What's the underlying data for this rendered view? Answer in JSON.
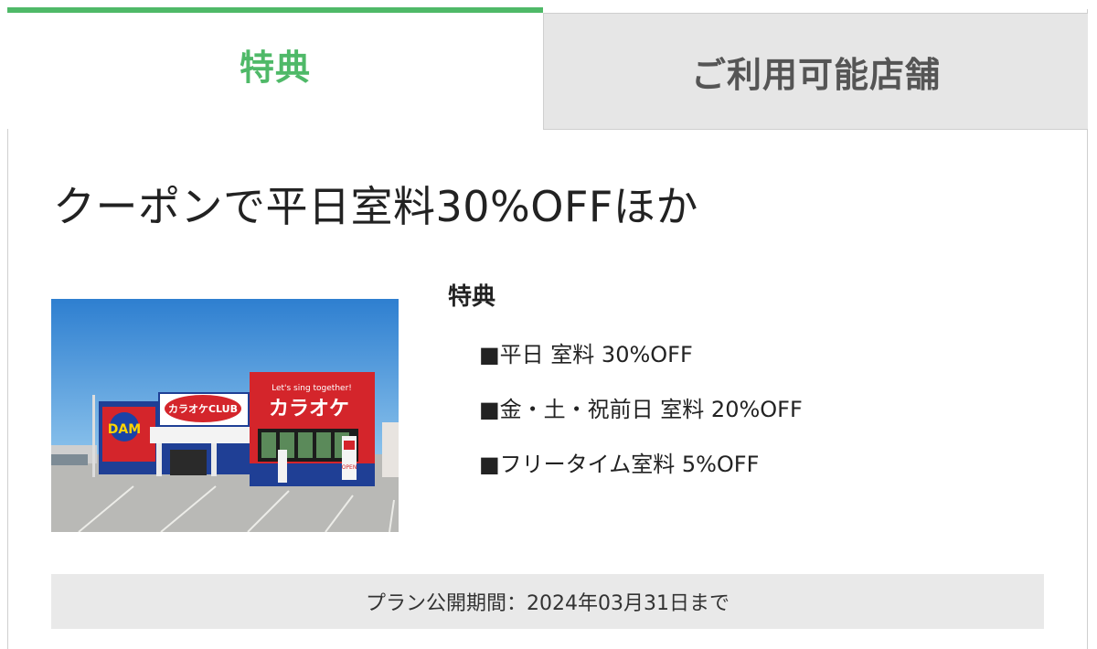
{
  "tabs": [
    {
      "label": "特典",
      "active": true
    },
    {
      "label": "ご利用可能店舗",
      "active": false
    }
  ],
  "colors": {
    "accent": "#4fb968",
    "inactive_tab_bg": "#e6e6e6",
    "period_bg": "#e9e9e9"
  },
  "headline": "クーポンで平日室料30%OFFほか",
  "photo": {
    "sign_main": "カラオケ",
    "sign_slogan": "Let's sing together!",
    "sign_club": "カラオケCLUB",
    "sign_dam": "DAM",
    "sign_open": "OPEN"
  },
  "benefits": {
    "title": "特典",
    "items": [
      "■平日 室料 30%OFF",
      "■金・土・祝前日 室料 20%OFF",
      "■フリータイム室料 5%OFF"
    ]
  },
  "period": "プラン公開期間：2024年03月31日まで"
}
